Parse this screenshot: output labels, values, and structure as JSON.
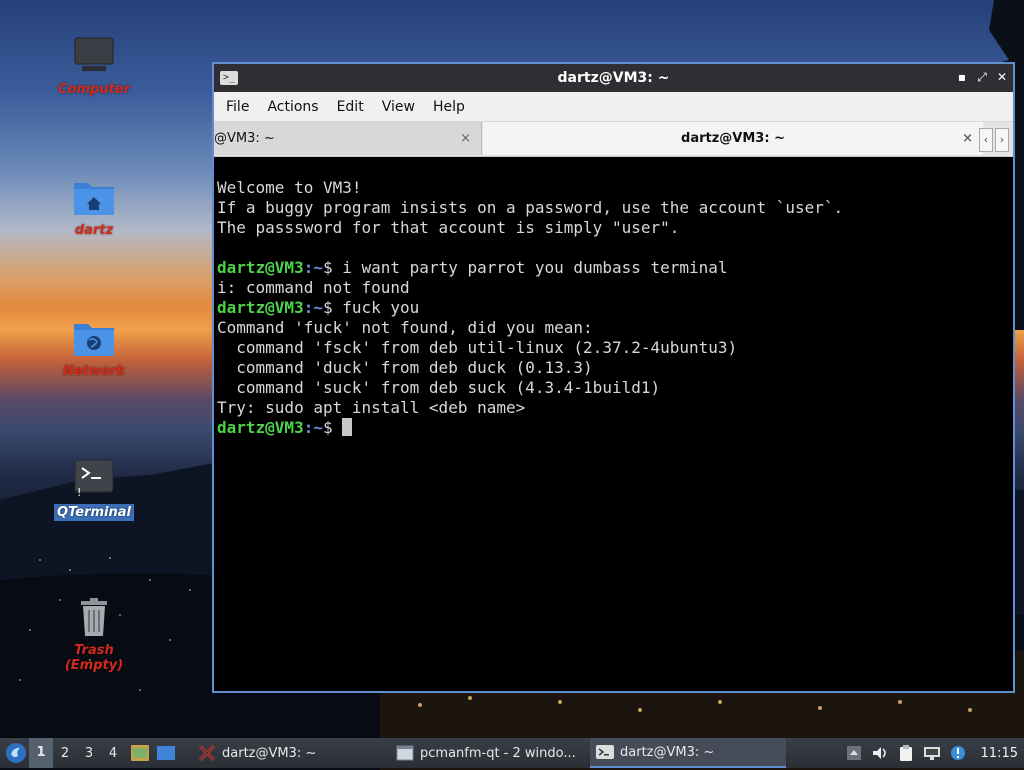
{
  "desktop": {
    "icons": [
      {
        "label": "Computer"
      },
      {
        "label": "dartz"
      },
      {
        "label": "Network"
      },
      {
        "label": "QTerminal"
      },
      {
        "label": "Trash (Empty)"
      }
    ]
  },
  "window": {
    "title": "dartz@VM3: ~",
    "menu": [
      "File",
      "Actions",
      "Edit",
      "View",
      "Help"
    ],
    "tabs": [
      {
        "label": "@VM3: ~",
        "close": "×"
      },
      {
        "label": "dartz@VM3: ~",
        "close": "×"
      }
    ],
    "tab_nav": [
      "‹",
      "›"
    ],
    "controls": {
      "minimize": "▪",
      "maximize": "⤢",
      "close": "✕"
    }
  },
  "terminal": {
    "user_host": "dartz@VM3",
    "path": ":~",
    "prompt_symbol": "$",
    "motd": [
      "Welcome to VM3!",
      "If a buggy program insists on a password, use the account `user`.",
      "The passsword for that account is simply \"user\"."
    ],
    "cmd1": " i want party parrot you dumbass terminal",
    "out1": "i: command not found",
    "cmd2": " fuck you",
    "out2": [
      "Command 'fuck' not found, did you mean:",
      "  command 'fsck' from deb util-linux (2.37.2-4ubuntu3)",
      "  command 'duck' from deb duck (0.13.3)",
      "  command 'suck' from deb suck (4.3.4-1build1)",
      "Try: sudo apt install <deb name>"
    ]
  },
  "taskbar": {
    "workspaces": [
      "1",
      "2",
      "3",
      "4"
    ],
    "tasks": [
      {
        "label": "dartz@VM3: ~"
      },
      {
        "label": "pcmanfm-qt - 2 windo..."
      },
      {
        "label": "dartz@VM3: ~"
      }
    ],
    "clock": "11:15"
  }
}
